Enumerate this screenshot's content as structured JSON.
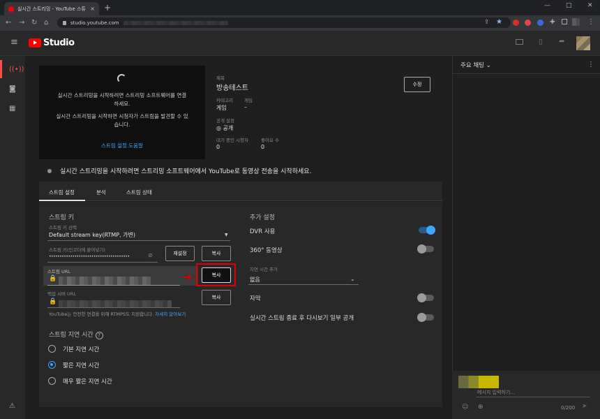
{
  "browser": {
    "tab_title": "실시간 스트리밍 - YouTube 스튜",
    "tab_close": "×",
    "new_tab": "+",
    "url": "studio.youtube.com",
    "window_min": "—",
    "window_max": "□",
    "window_close": "✕"
  },
  "header": {
    "brand": "Studio"
  },
  "preview": {
    "msg1_line1": "실시간 스트리밍을 시작하려면 스트리밍 소프트웨어를 연결",
    "msg1_line2": "하세요.",
    "msg2_line1": "실시간 스트리밍을 시작하면 시청자가 스트림을 발견할 수 있",
    "msg2_line2": "습니다.",
    "guide_link": "스트림 설정 도움말"
  },
  "details": {
    "title_label": "제목",
    "title_value": "방송테스트",
    "category_label": "카테고리",
    "category_value": "게임",
    "game_label": "게임",
    "game_value": "–",
    "visibility_label": "공개 설정",
    "visibility_value": "공개",
    "waiting_label": "대기 중인 시청자",
    "waiting_value": "0",
    "likes_label": "좋아요 수",
    "likes_value": "0",
    "edit_button": "수정"
  },
  "notice": "실시간 스트리밍을 시작하려면 스트리밍 소프트웨어에서 YouTube로 동영상 전송을 시작하세요.",
  "tabs": [
    "스트림 설정",
    "분석",
    "스트림 상태"
  ],
  "stream_key": {
    "section_title": "스트림 키",
    "select_label": "스트림 키 선택",
    "select_value": "Default stream key(RTMP, 가변)",
    "key_label": "스트림 키(인코더에 붙여넣기)",
    "key_value": "••••••••••••••••••••••••••••••••••••••",
    "reset_button": "재설정",
    "copy_key_button": "복사",
    "url_label": "스트림 URL",
    "copy_url_button": "복사",
    "backup_label": "백업 서버 URL",
    "copy_backup_button": "복사",
    "rtmps_note": "YouTube는 안전한 연결을 위해 RTMPS도 지원합니다.",
    "learn_more": "자세히 알아보기"
  },
  "latency": {
    "title": "스트림 지연 시간",
    "help": "?",
    "options": [
      "기본 지연 시간",
      "짧은 지연 시간",
      "매우 짧은 지연 시간"
    ],
    "selected": "짧은 지연 시간"
  },
  "additional": {
    "title": "추가 설정",
    "dvr": "DVR 사용",
    "dvr_on": true,
    "video360": "360° 동영상",
    "video360_on": false,
    "delay_label": "지연 시간 추가",
    "delay_value": "없음",
    "captions": "자막",
    "captions_on": false,
    "unlisted_replay": "실시간 스트림 종료 후 다시보기 일부 공개",
    "unlisted_replay_on": false
  },
  "chat": {
    "header": "주요 채팅",
    "input_placeholder": "메시지 입력하기...",
    "counter": "0/200"
  },
  "colors": {
    "accent_blue": "#3ea6ff",
    "youtube_red": "#ff0000",
    "highlight_red": "#e00000"
  }
}
